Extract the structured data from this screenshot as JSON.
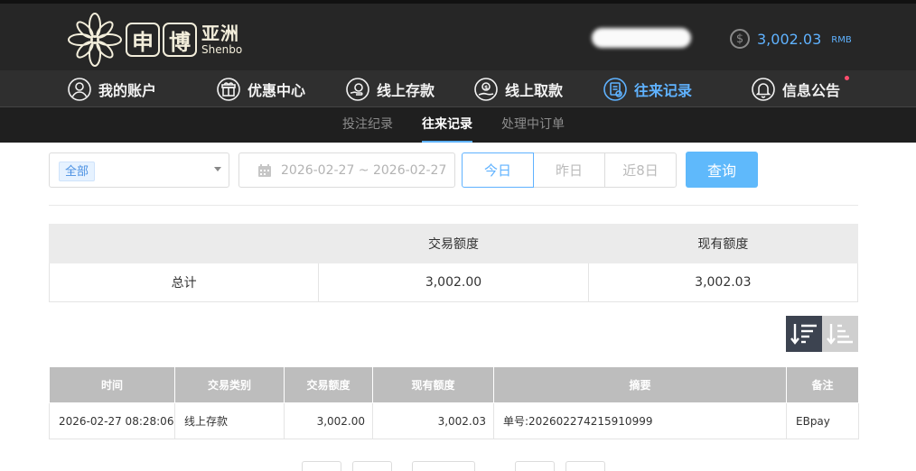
{
  "brand": {
    "logo_box_1": "申",
    "logo_box_2": "博",
    "logo_cn": "亚洲",
    "logo_en": "Shenbo"
  },
  "account": {
    "balance": "3,002.03",
    "currency": "RMB",
    "balance_icon": "dollar-coin-icon"
  },
  "main_nav": [
    {
      "label": "我的账户",
      "icon": "user-icon"
    },
    {
      "label": "优惠中心",
      "icon": "gift-icon"
    },
    {
      "label": "线上存款",
      "icon": "deposit-icon"
    },
    {
      "label": "线上取款",
      "icon": "withdraw-icon"
    },
    {
      "label": "往来记录",
      "icon": "records-icon",
      "active": true
    },
    {
      "label": "信息公告",
      "icon": "bell-icon",
      "has_notification": true
    }
  ],
  "sub_nav": [
    {
      "label": "投注纪录"
    },
    {
      "label": "往来记录",
      "active": true
    },
    {
      "label": "处理中订单"
    }
  ],
  "filters": {
    "type_selected": "全部",
    "date_range": "2026-02-27 ~ 2026-02-27",
    "quick_ranges": [
      "今日",
      "昨日",
      "近8日"
    ],
    "quick_active": "今日",
    "query_label": "查询"
  },
  "summary": {
    "headers": [
      "",
      "交易额度",
      "现有额度"
    ],
    "row": [
      "总计",
      "3,002.00",
      "3,002.03"
    ]
  },
  "sort": {
    "desc_icon": "sort-descending-icon",
    "asc_icon": "sort-ascending-icon",
    "active": "desc"
  },
  "records": {
    "headers": [
      "时间",
      "交易类别",
      "交易额度",
      "现有额度",
      "摘要",
      "备注"
    ],
    "rows": [
      [
        "2026-02-27 08:28:06",
        "线上存款",
        "3,002.00",
        "3,002.03",
        "单号:202602274215910999",
        "EBpay"
      ]
    ]
  },
  "colors": {
    "accent": "#5fb2ff",
    "header_bg": "#262626",
    "nav_bg": "#2f2f2f",
    "subnav_bg": "#1f1f1f",
    "query_button": "#5fb9fb",
    "notification_dot": "#ff4d6d"
  }
}
